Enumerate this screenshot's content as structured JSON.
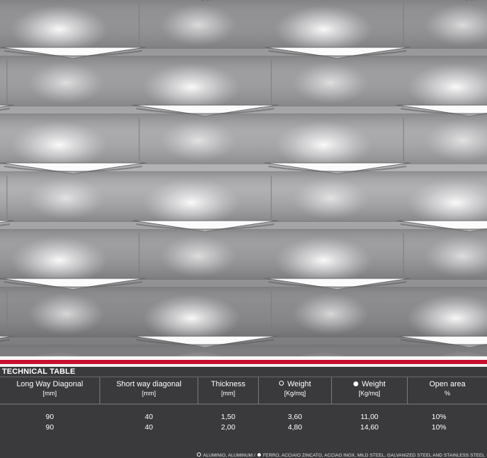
{
  "table_title": "TECHNICAL TABLE",
  "columns": [
    {
      "label": "Long Way Diagonal",
      "unit": "[mm]",
      "marker": ""
    },
    {
      "label": "Short way diagonal",
      "unit": "[mm]",
      "marker": ""
    },
    {
      "label": "Thickness",
      "unit": "[mm]",
      "marker": ""
    },
    {
      "label": "Weight",
      "unit": "[Kg/mq]",
      "marker": "hollow"
    },
    {
      "label": "Weight",
      "unit": "[Kg/mq]",
      "marker": "filled"
    },
    {
      "label": "Open area",
      "unit": "%",
      "marker": ""
    }
  ],
  "rows": [
    [
      "90",
      "40",
      "1,50",
      "3,60",
      "11,00",
      "10%"
    ],
    [
      "90",
      "40",
      "2,00",
      "4,80",
      "14,60",
      "10%"
    ]
  ],
  "footer": {
    "hollow_text": "ALUMINIO, ALUMINUM /",
    "filled_text": "FERRO, ACCIAIO ZINCATO, ACCIAO INOX, MILD STEEL, GALVANIZED STEEL AND STAINLESS STEEL"
  },
  "colors": {
    "accent_red": "#c8102e",
    "panel": "#3a3a3c"
  }
}
